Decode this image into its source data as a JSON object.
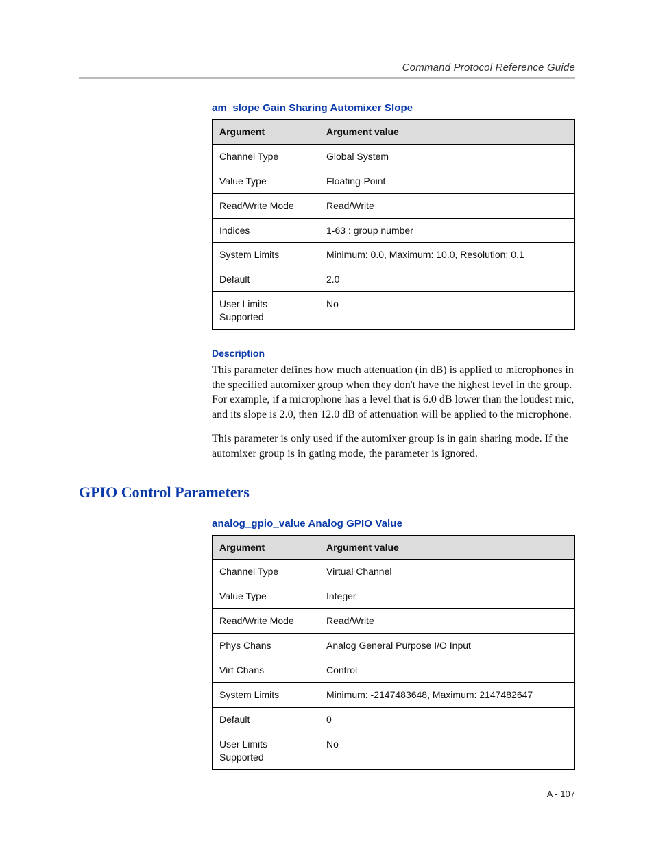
{
  "header": {
    "running_title": "Command Protocol Reference Guide"
  },
  "sub1": {
    "title": "am_slope Gain Sharing Automixer Slope",
    "th_arg": "Argument",
    "th_val": "Argument value",
    "rows": [
      {
        "arg": "Channel Type",
        "val": "Global System"
      },
      {
        "arg": "Value Type",
        "val": "Floating-Point"
      },
      {
        "arg": "Read/Write Mode",
        "val": "Read/Write"
      },
      {
        "arg": "Indices",
        "val": "1-63 : group number"
      },
      {
        "arg": "System Limits",
        "val": "Minimum: 0.0, Maximum: 10.0, Resolution: 0.1"
      },
      {
        "arg": "Default",
        "val": "2.0"
      },
      {
        "arg": "User Limits Supported",
        "val": "No"
      }
    ],
    "desc_label": "Description",
    "desc_p1": "This parameter defines how much attenuation (in dB) is applied to microphones in the specified automixer group when they don't have the highest level in the group. For example, if a microphone has a level that is 6.0 dB lower than the loudest mic, and its slope is 2.0, then 12.0 dB of attenuation will be applied to the microphone.",
    "desc_p2": "This parameter is only used if the automixer group is in gain sharing mode. If the automixer group is in gating mode, the parameter is ignored."
  },
  "section2": {
    "heading": "GPIO Control Parameters"
  },
  "sub2": {
    "title": "analog_gpio_value Analog GPIO Value",
    "th_arg": "Argument",
    "th_val": "Argument value",
    "rows": [
      {
        "arg": "Channel Type",
        "val": "Virtual Channel"
      },
      {
        "arg": "Value Type",
        "val": "Integer"
      },
      {
        "arg": "Read/Write Mode",
        "val": "Read/Write"
      },
      {
        "arg": "Phys Chans",
        "val": "Analog General Purpose I/O Input"
      },
      {
        "arg": "Virt Chans",
        "val": "Control"
      },
      {
        "arg": "System Limits",
        "val": "Minimum: -2147483648, Maximum: 2147482647"
      },
      {
        "arg": "Default",
        "val": "0"
      },
      {
        "arg": "User Limits Supported",
        "val": "No"
      }
    ]
  },
  "footer": {
    "page": "A - 107"
  }
}
